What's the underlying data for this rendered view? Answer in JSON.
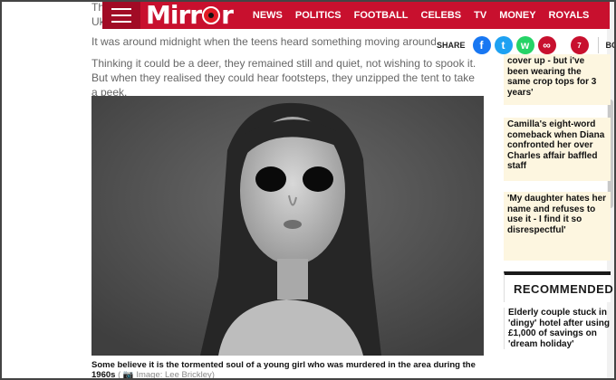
{
  "header": {
    "logo_left": "Mirr",
    "logo_right": "r",
    "nav": [
      "NEWS",
      "POLITICS",
      "FOOTBALL",
      "CELEBS",
      "TV",
      "MONEY",
      "ROYALS"
    ]
  },
  "article": {
    "top_fragment_1": "Th",
    "top_fragment_2": "Uk",
    "paragraph1": "It was around midnight when the teens heard something moving around outsic",
    "paragraph2": "Thinking it could be a deer, they remained still and quiet, not wishing to spook it. But when they realised they could hear footsteps, they unzipped the tent to take a peek.",
    "caption": "Some believe it is the tormented soul of a young girl who was murdered in the area during the 1960s",
    "credit": "( 📷 Image: Lee Brickley)"
  },
  "share": {
    "label": "SHARE",
    "facebook_glyph": "f",
    "twitter_glyph": "t",
    "whatsapp_glyph": "w",
    "link_glyph": "∞",
    "comments": "7",
    "bc": "BC"
  },
  "sidebar": {
    "card1": "cover up - but i've been wearing the same crop tops for 3 years'",
    "card2": "Camilla's eight-word comeback when Diana confronted her over Charles affair baffled staff",
    "card3": "'My daughter hates her name and refuses to use it - I find it so disrespectful'",
    "recommended": "RECOMMENDED",
    "rec1": "Elderly couple stuck in 'dingy' hotel after using £1,000 of savings on 'dream holiday'"
  },
  "colors": {
    "brand": "#c8102e",
    "card_bg": "#fdf6e0"
  }
}
